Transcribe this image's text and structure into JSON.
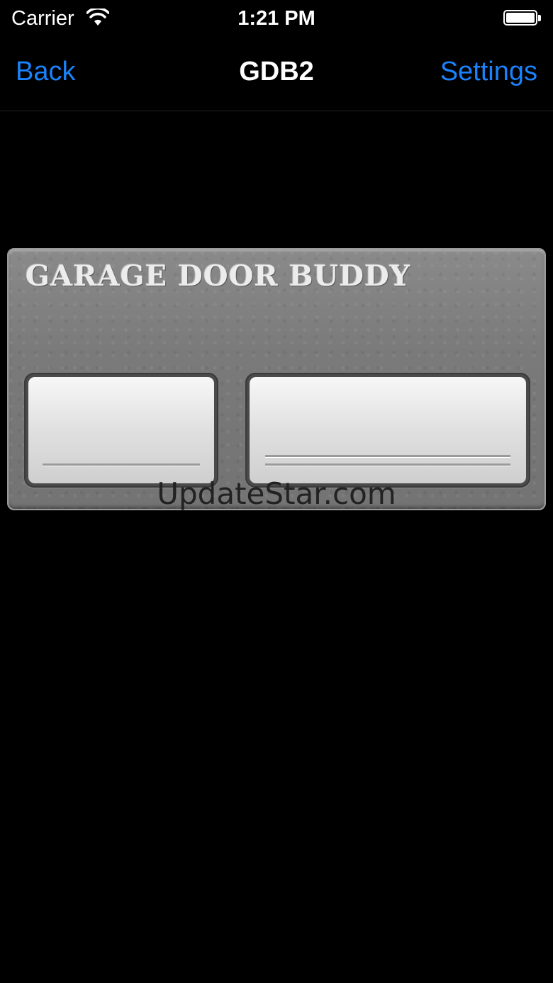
{
  "status_bar": {
    "carrier": "Carrier",
    "time": "1:21 PM",
    "wifi_icon": "wifi-icon",
    "battery_icon": "battery-icon"
  },
  "nav_bar": {
    "back_label": "Back",
    "title": "GDB2",
    "settings_label": "Settings",
    "accent_color": "#1a82fb"
  },
  "panel": {
    "logo_text": "GARAGE DOOR BUDDY",
    "doors": [
      {
        "id": "door-1"
      },
      {
        "id": "door-2"
      }
    ]
  },
  "watermark": "UpdateStar.com"
}
